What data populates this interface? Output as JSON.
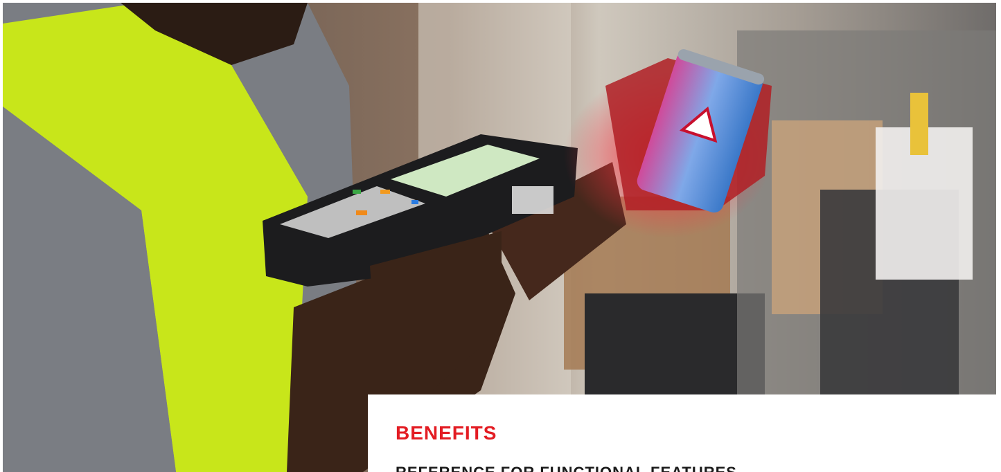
{
  "hero": {
    "image_subject": "warehouse-worker-scanning-can",
    "colors": {
      "vest": "#c8e61a",
      "shirt": "#7a7d83",
      "skin": "#3a2418",
      "scanner_body": "#1c1c1e",
      "scanner_screen": "#cfe8c2",
      "scan_light": "#ff2a3a",
      "can": "#4a9ee0"
    }
  },
  "section": {
    "heading": "BENEFITS",
    "subheading": "REFERENCE FOR FUNCTIONAL FEATURES",
    "accent_color": "#e31c23"
  }
}
